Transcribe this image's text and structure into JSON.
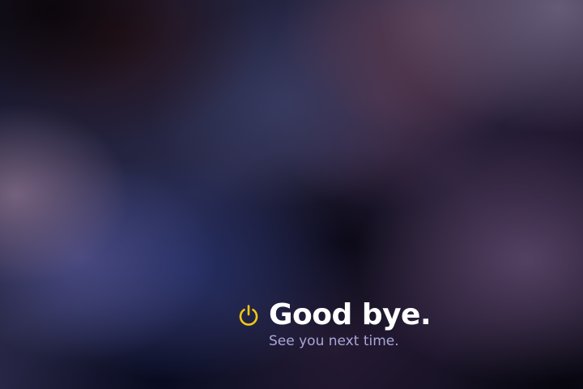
{
  "screen": {
    "icon": "power-icon",
    "title": "Good bye.",
    "subtitle": "See you next time."
  },
  "colors": {
    "icon": "#f2c811",
    "title": "#ffffff",
    "subtitle": "#a9a6d8"
  }
}
